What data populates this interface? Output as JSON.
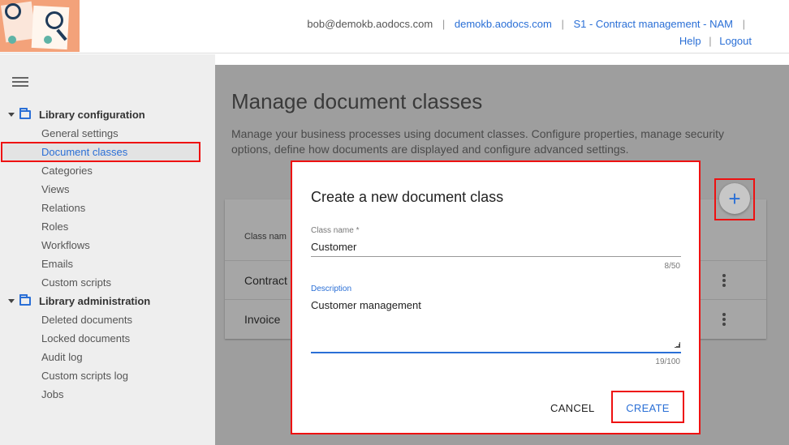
{
  "header": {
    "user_email": "bob@demokb.aodocs.com",
    "domain_link": "demokb.aodocs.com",
    "library_link": "S1 - Contract management - NAM",
    "help_link": "Help",
    "logout_link": "Logout",
    "separator": "|"
  },
  "sidebar": {
    "sections": [
      {
        "label": "Library configuration",
        "items": [
          "General settings",
          "Document classes",
          "Categories",
          "Views",
          "Relations",
          "Roles",
          "Workflows",
          "Emails",
          "Custom scripts"
        ]
      },
      {
        "label": "Library administration",
        "items": [
          "Deleted documents",
          "Locked documents",
          "Audit log",
          "Custom scripts log",
          "Jobs"
        ]
      }
    ],
    "active_item": "Document classes"
  },
  "main": {
    "title": "Manage document classes",
    "description": "Manage your business processes using document classes. Configure properties, manage security options, define how documents are displayed and configure advanced settings.",
    "table": {
      "header": "Class nam",
      "rows": [
        "Contract",
        "Invoice"
      ]
    },
    "add_button": "+"
  },
  "dialog": {
    "title": "Create a new document class",
    "class_name": {
      "label": "Class name *",
      "value": "Customer",
      "counter": "8/50"
    },
    "description": {
      "label": "Description",
      "value": "Customer management",
      "counter": "19/100"
    },
    "cancel_label": "CANCEL",
    "create_label": "CREATE"
  },
  "colors": {
    "accent": "#2a6fd6",
    "highlight_border": "#e11111",
    "overlay": "#9e9e9e"
  }
}
